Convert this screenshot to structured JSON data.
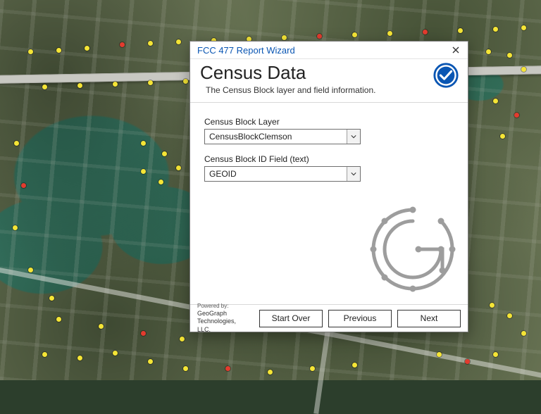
{
  "dialog": {
    "window_title": "FCC 477 Report Wizard",
    "step_title": "Census Data",
    "subtitle": "The Census Block layer and field information.",
    "fields": {
      "layer": {
        "label": "Census Block Layer",
        "value": "CensusBlockClemson"
      },
      "id_field": {
        "label": "Census Block ID Field (text)",
        "value": "GEOID"
      }
    },
    "footer": {
      "powered_label": "Powered by:",
      "company": "GeoGraph Technologies, LLC.",
      "buttons": {
        "start_over": "Start Over",
        "previous": "Previous",
        "next": "Next"
      }
    }
  },
  "map": {
    "description": "Aerial imagery with green lake, road corridor, and parcel point markers.",
    "marker_colors": {
      "primary": "#f5e536",
      "secondary": "#e33b2e"
    }
  }
}
